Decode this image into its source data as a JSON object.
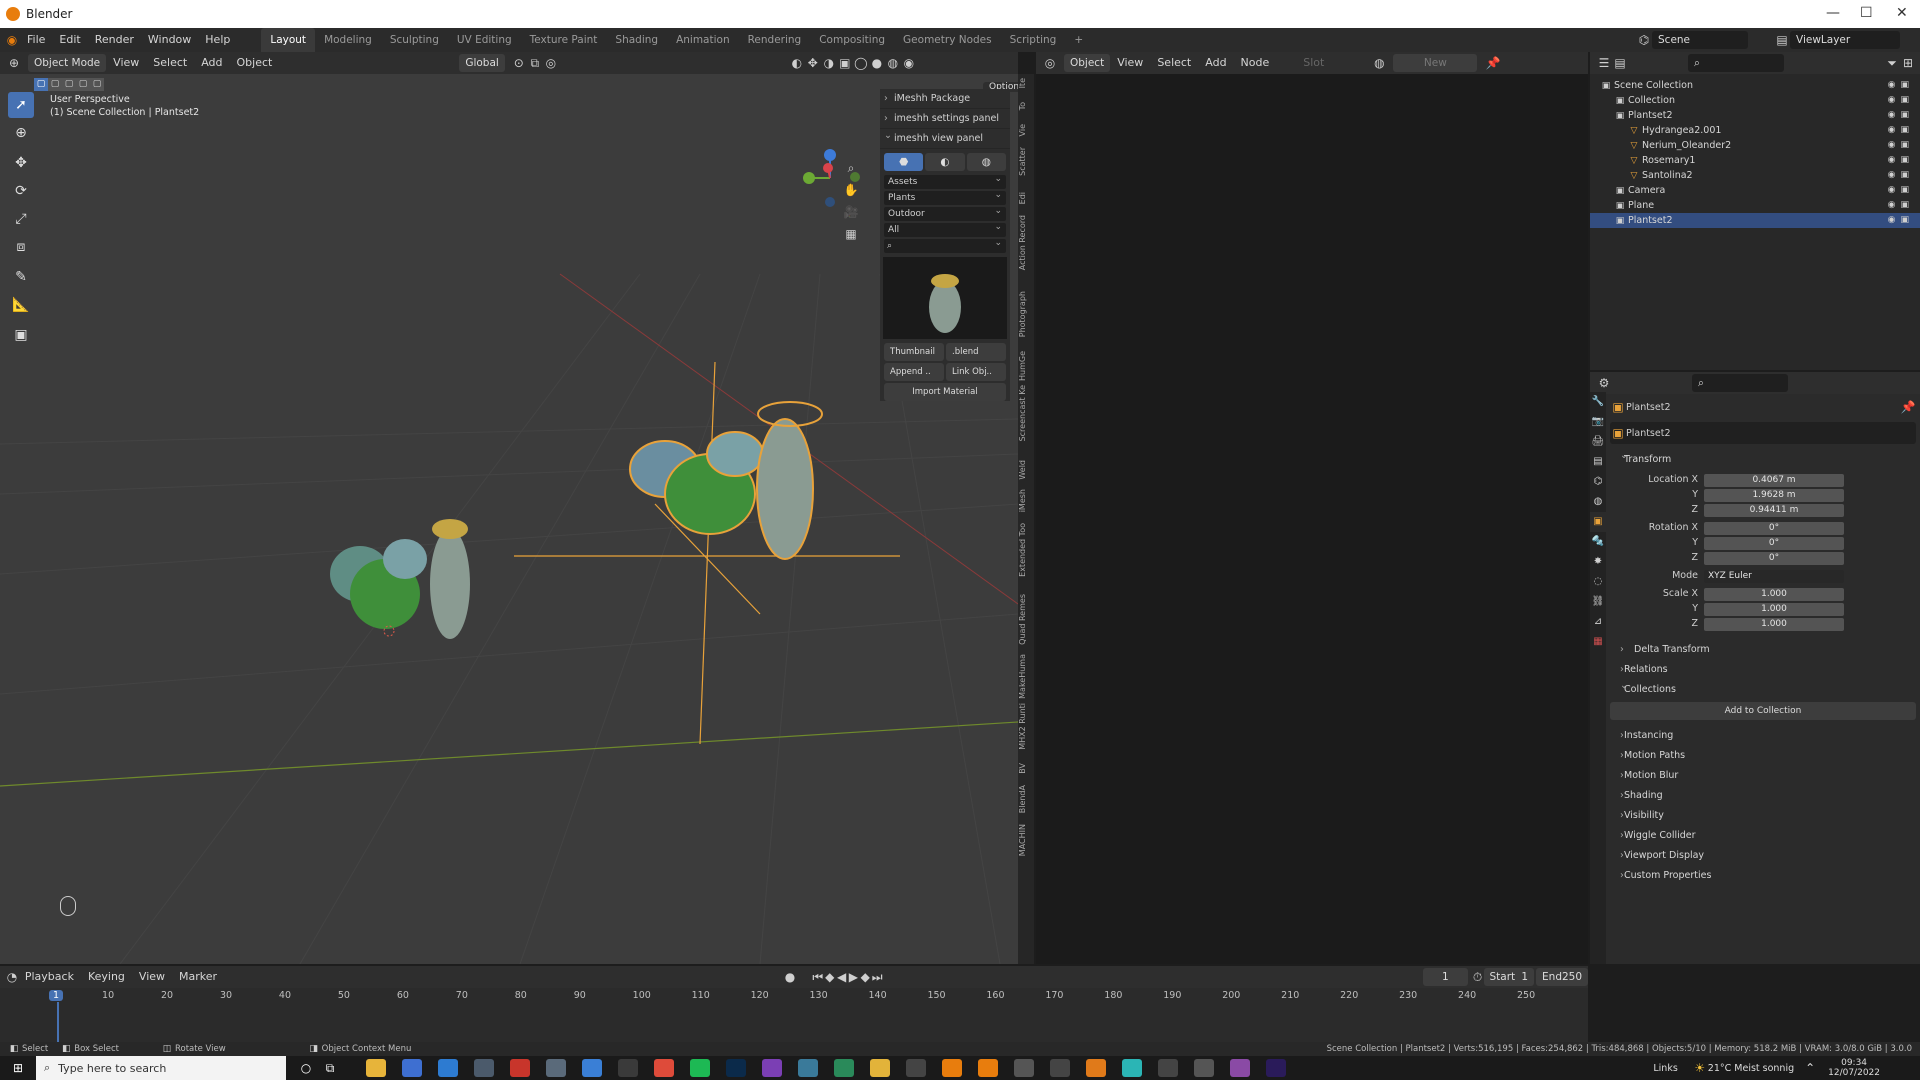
{
  "window": {
    "title": "Blender"
  },
  "menu": [
    "File",
    "Edit",
    "Render",
    "Window",
    "Help"
  ],
  "workspaces": [
    "Layout",
    "Modeling",
    "Sculpting",
    "UV Editing",
    "Texture Paint",
    "Shading",
    "Animation",
    "Rendering",
    "Compositing",
    "Geometry Nodes",
    "Scripting"
  ],
  "active_workspace": "Layout",
  "scene": {
    "name": "Scene",
    "view_layer": "ViewLayer"
  },
  "viewport": {
    "mode": "Object Mode",
    "menus": [
      "View",
      "Select",
      "Add",
      "Object"
    ],
    "transform_orientation": "Global",
    "options_label": "Options",
    "info_line1": "User Perspective",
    "info_line2": "(1) Scene Collection | Plantset2"
  },
  "npanel": {
    "sections": [
      "iMeshh Package",
      "imeshh settings panel",
      "imeshh view panel"
    ],
    "selects": [
      "Assets",
      "Plants",
      "Outdoor",
      "All"
    ],
    "thumbnail_label": "Thumbnail",
    "blend_label": ".blend",
    "append_label": "Append ..",
    "link_label": "Link Obj..",
    "import_material_label": "Import Material"
  },
  "side_tabs": [
    "Ite",
    "To",
    "Vie",
    "Scatter",
    "Edi",
    "Action Record",
    "Photograph",
    "HumGe",
    "Screencast Ke",
    "Weld",
    "iMesh",
    "Extended Too",
    "Quad Remes",
    "MakeHuma",
    "MHX2 Runti",
    "BV",
    "BlendA",
    "MACHIN"
  ],
  "node_editor": {
    "menus": [
      "Object",
      "View",
      "Select",
      "Add",
      "Node"
    ],
    "slot_label": "Slot",
    "new_label": "New"
  },
  "outliner": {
    "rows": [
      {
        "label": "Scene Collection",
        "indent": 0,
        "selected": false
      },
      {
        "label": "Collection",
        "indent": 1,
        "selected": false
      },
      {
        "label": "Plantset2",
        "indent": 1,
        "selected": false
      },
      {
        "label": "Hydrangea2.001",
        "indent": 2,
        "selected": false
      },
      {
        "label": "Nerium_Oleander2",
        "indent": 2,
        "selected": false
      },
      {
        "label": "Rosemary1",
        "indent": 2,
        "selected": false
      },
      {
        "label": "Santolina2",
        "indent": 2,
        "selected": false
      },
      {
        "label": "Camera",
        "indent": 1,
        "selected": false
      },
      {
        "label": "Plane",
        "indent": 1,
        "selected": false
      },
      {
        "label": "Plantset2",
        "indent": 1,
        "selected": true
      }
    ]
  },
  "properties": {
    "object_name": "Plantset2",
    "object_data_name": "Plantset2",
    "transform_label": "Transform",
    "location": {
      "label": "Location X",
      "x": "0.4067 m",
      "y": "1.9628 m",
      "z": "0.94411 m"
    },
    "rotation": {
      "label": "Rotation X",
      "x": "0°",
      "y": "0°",
      "z": "0°"
    },
    "mode_label": "Mode",
    "mode_value": "XYZ Euler",
    "scale": {
      "label": "Scale X",
      "x": "1.000",
      "y": "1.000",
      "z": "1.000"
    },
    "axis_y": "Y",
    "axis_z": "Z",
    "delta_transform": "Delta Transform",
    "sections": [
      "Relations",
      "Collections"
    ],
    "add_to_collection": "Add to Collection",
    "sections2": [
      "Instancing",
      "Motion Paths",
      "Motion Blur",
      "Shading",
      "Visibility",
      "Wiggle Collider",
      "Viewport Display",
      "Custom Properties"
    ]
  },
  "timeline": {
    "menus": [
      "Playback",
      "Keying",
      "View",
      "Marker"
    ],
    "current_frame": "1",
    "start_label": "Start",
    "start": "1",
    "end_label": "End",
    "end": "250",
    "ticks": [
      "1",
      "10",
      "20",
      "30",
      "40",
      "50",
      "60",
      "70",
      "80",
      "90",
      "100",
      "110",
      "120",
      "130",
      "140",
      "150",
      "160",
      "170",
      "180",
      "190",
      "200",
      "210",
      "220",
      "230",
      "240",
      "250"
    ]
  },
  "statusbar": {
    "select": "Select",
    "box_select": "Box Select",
    "rotate_view": "Rotate View",
    "context_menu": "Object Context Menu",
    "stats": "Scene Collection | Plantset2 | Verts:516,195 | Faces:254,862 | Tris:484,868 | Objects:5/10 | Memory: 518.2 MiB | VRAM: 3.0/8.0 GiB | 3.0.0"
  },
  "taskbar": {
    "search_placeholder": "Type here to search",
    "links": "Links",
    "weather": "21°C  Meist sonnig",
    "time": "09:34",
    "date": "12/07/2022"
  },
  "colors": {
    "accent": "#4772b3",
    "selection_orange": "#e8a23a",
    "plant_green": "#3f8f3a"
  }
}
